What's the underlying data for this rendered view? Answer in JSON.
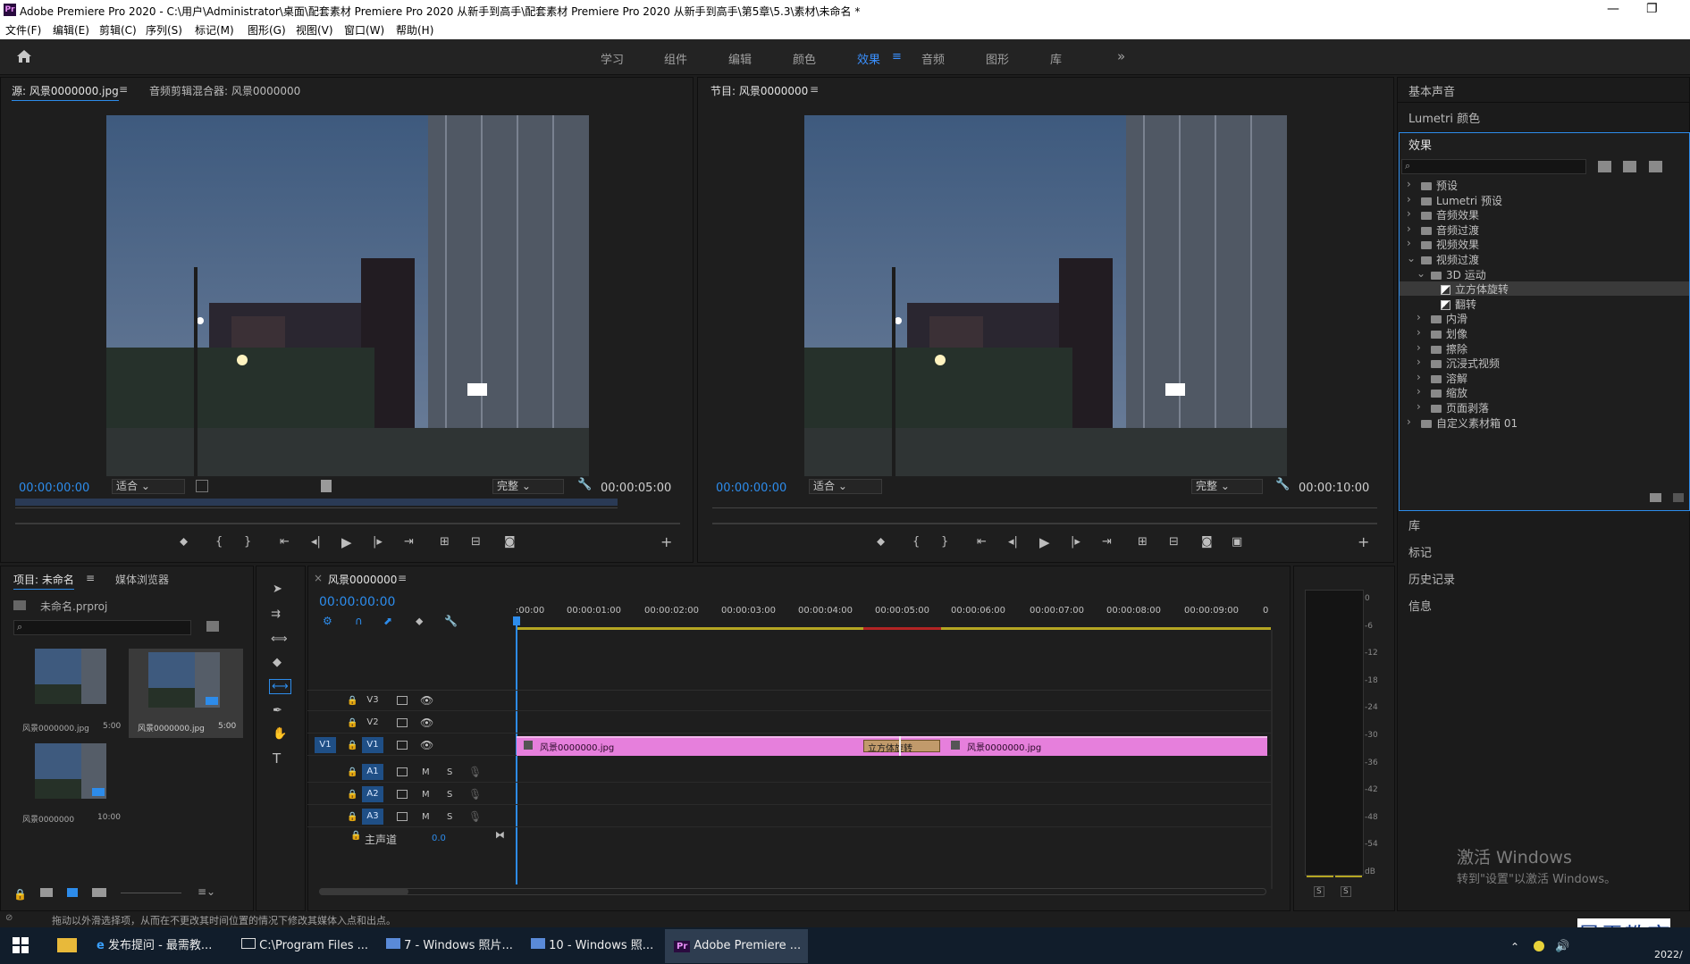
{
  "window": {
    "title": "Adobe Premiere Pro 2020 - C:\\用户\\Administrator\\桌面\\配套素材 Premiere Pro 2020 从新手到高手\\配套素材 Premiere Pro 2020 从新手到高手\\第5章\\5.3\\素材\\未命名 *",
    "app_logo": "Pr",
    "minimize": "—",
    "restore": "❐",
    "close": "✕"
  },
  "menu": [
    "文件(F)",
    "编辑(E)",
    "剪辑(C)",
    "序列(S)",
    "标记(M)",
    "图形(G)",
    "视图(V)",
    "窗口(W)",
    "帮助(H)"
  ],
  "workspaces": {
    "items": [
      "学习",
      "组件",
      "编辑",
      "颜色",
      "效果",
      "音频",
      "图形",
      "库"
    ],
    "active": "效果",
    "more": "»",
    "home_icon": "home-icon",
    "menu_glyph": "≡"
  },
  "source": {
    "tab1": "源: 风景0000000.jpg",
    "tab2": "音频剪辑混合器: 风景0000000",
    "timecode_in": "00:00:00:00",
    "fit": "适合",
    "quality": "完整",
    "duration": "00:00:05:00"
  },
  "program": {
    "tab": "节目: 风景0000000",
    "timecode_in": "00:00:00:00",
    "fit": "适合",
    "quality": "完整",
    "duration": "00:00:10:00"
  },
  "right_panels": {
    "basic_sound": "基本声音",
    "lumetri": "Lumetri 颜色",
    "effects_title": "效果",
    "library": "库",
    "markers": "标记",
    "history": "历史记录",
    "info": "信息"
  },
  "effects_tree": [
    {
      "label": "预设",
      "level": 0,
      "kind": "folder",
      "exp": "›"
    },
    {
      "label": "Lumetri 预设",
      "level": 0,
      "kind": "folder",
      "exp": "›"
    },
    {
      "label": "音频效果",
      "level": 0,
      "kind": "folder",
      "exp": "›"
    },
    {
      "label": "音频过渡",
      "level": 0,
      "kind": "folder",
      "exp": "›"
    },
    {
      "label": "视频效果",
      "level": 0,
      "kind": "folder",
      "exp": "›"
    },
    {
      "label": "视频过渡",
      "level": 0,
      "kind": "folder",
      "exp": "⌄"
    },
    {
      "label": "3D 运动",
      "level": 1,
      "kind": "folder",
      "exp": "⌄"
    },
    {
      "label": "立方体旋转",
      "level": 2,
      "kind": "fx",
      "exp": "",
      "selected": true
    },
    {
      "label": "翻转",
      "level": 2,
      "kind": "fx",
      "exp": ""
    },
    {
      "label": "内滑",
      "level": 1,
      "kind": "folder",
      "exp": "›"
    },
    {
      "label": "划像",
      "level": 1,
      "kind": "folder",
      "exp": "›"
    },
    {
      "label": "擦除",
      "level": 1,
      "kind": "folder",
      "exp": "›"
    },
    {
      "label": "沉浸式视频",
      "level": 1,
      "kind": "folder",
      "exp": "›"
    },
    {
      "label": "溶解",
      "level": 1,
      "kind": "folder",
      "exp": "›"
    },
    {
      "label": "缩放",
      "level": 1,
      "kind": "folder",
      "exp": "›"
    },
    {
      "label": "页面剥落",
      "level": 1,
      "kind": "folder",
      "exp": "›"
    },
    {
      "label": "自定义素材箱 01",
      "level": 0,
      "kind": "folder",
      "exp": "›"
    }
  ],
  "project": {
    "tab1": "项目: 未命名",
    "tab2": "媒体浏览器",
    "file": "未命名.prproj",
    "items": [
      {
        "name": "风景0000000.jpg",
        "dur": "5:00"
      },
      {
        "name": "风景0000000.jpg",
        "dur": "5:00"
      },
      {
        "name": "风景0000000",
        "dur": "10:00"
      }
    ]
  },
  "timeline": {
    "tab": "风景0000000",
    "timecode": "00:00:00:00",
    "ruler": [
      ":00:00",
      "00:00:01:00",
      "00:00:02:00",
      "00:00:03:00",
      "00:00:04:00",
      "00:00:05:00",
      "00:00:06:00",
      "00:00:07:00",
      "00:00:08:00",
      "00:00:09:00",
      "0"
    ],
    "tracks": [
      {
        "name": "V3"
      },
      {
        "name": "V2"
      },
      {
        "name": "V1",
        "source": "V1"
      },
      {
        "name": "A1"
      },
      {
        "name": "A2"
      },
      {
        "name": "A3"
      }
    ],
    "master": "主声道",
    "master_val": "0.0",
    "clip1": "风景0000000.jpg",
    "clip2": "风景0000000.jpg",
    "transition": "立方体旋转",
    "mute": "M",
    "solo": "S"
  },
  "meter": {
    "labels": [
      "0",
      "-6",
      "-12",
      "-18",
      "-24",
      "-30",
      "-36",
      "-42",
      "-48",
      "-54",
      "dB"
    ],
    "s": "S"
  },
  "status": "拖动以外滑选择项，从而在不更改其时间位置的情况下修改其媒体入点和出点。",
  "watermark": {
    "line1": "激活 Windows",
    "line2": "转到\"设置\"以激活 Windows。",
    "brand": "最需教育"
  },
  "taskbar": {
    "items": [
      "发布提问 - 最需教...",
      "C:\\Program Files ...",
      "7 - Windows 照片...",
      "10 - Windows 照...",
      "Adobe Premiere ..."
    ],
    "clock": "2022/"
  }
}
